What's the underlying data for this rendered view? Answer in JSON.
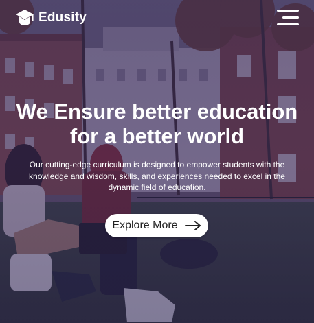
{
  "brand": {
    "name": "Edusity",
    "logo_icon": "graduation-cap-icon"
  },
  "nav": {
    "menu_icon": "hamburger-menu-icon"
  },
  "hero": {
    "title_line1": "We Ensure better education",
    "title_line2": "for a better world",
    "description": "Our cutting-edge curriculum is designed to empower students with the knowledge and wisdom, skills, and experiences needed to excel in the dynamic field of education.",
    "cta_label": "Explore More",
    "cta_icon": "arrow-right-icon"
  },
  "colors": {
    "overlay": "#34265a",
    "text": "#ffffff",
    "button_bg": "#ffffff",
    "button_text": "#212121"
  }
}
